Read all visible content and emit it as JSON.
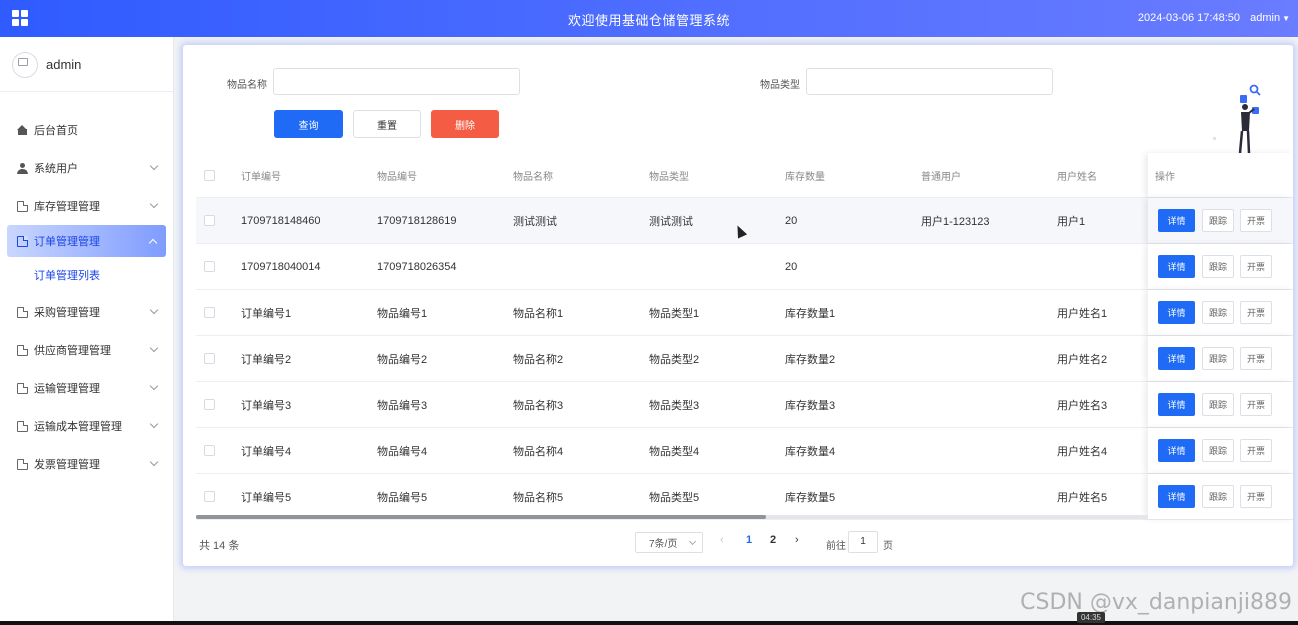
{
  "header": {
    "title": "欢迎使用基础仓储管理系统",
    "datetime": "2024-03-06 17:48:50",
    "user": "admin"
  },
  "sidebar": {
    "username": "admin",
    "items": [
      {
        "label": "后台首页",
        "icon": "home-icon"
      },
      {
        "label": "系统用户",
        "icon": "user-icon"
      },
      {
        "label": "库存管理管理",
        "icon": "document-icon"
      },
      {
        "label": "订单管理管理",
        "icon": "document-icon",
        "active": true
      },
      {
        "label": "采购管理管理",
        "icon": "document-icon"
      },
      {
        "label": "供应商管理管理",
        "icon": "document-icon"
      },
      {
        "label": "运输管理管理",
        "icon": "document-icon"
      },
      {
        "label": "运输成本管理管理",
        "icon": "document-icon"
      },
      {
        "label": "发票管理管理",
        "icon": "document-icon"
      }
    ],
    "subitem": "订单管理列表"
  },
  "search": {
    "name_label": "物品名称",
    "type_label": "物品类型",
    "query_button": "查询",
    "reset_button": "重置",
    "delete_button": "删除"
  },
  "table": {
    "headers": [
      "订单编号",
      "物品编号",
      "物品名称",
      "物品类型",
      "库存数量",
      "普通用户",
      "用户姓名",
      "操作"
    ],
    "actions": [
      "详情",
      "跟踪",
      "开票"
    ],
    "rows": [
      [
        "1709718148460",
        "1709718128619",
        "测试测试",
        "测试测试",
        "20",
        "用户1-123123",
        "用户1"
      ],
      [
        "1709718040014",
        "1709718026354",
        "",
        "",
        "20",
        "",
        ""
      ],
      [
        "订单编号1",
        "物品编号1",
        "物品名称1",
        "物品类型1",
        "库存数量1",
        "",
        "用户姓名1"
      ],
      [
        "订单编号2",
        "物品编号2",
        "物品名称2",
        "物品类型2",
        "库存数量2",
        "",
        "用户姓名2"
      ],
      [
        "订单编号3",
        "物品编号3",
        "物品名称3",
        "物品类型3",
        "库存数量3",
        "",
        "用户姓名3"
      ],
      [
        "订单编号4",
        "物品编号4",
        "物品名称4",
        "物品类型4",
        "库存数量4",
        "",
        "用户姓名4"
      ],
      [
        "订单编号5",
        "物品编号5",
        "物品名称5",
        "物品类型5",
        "库存数量5",
        "",
        "用户姓名5"
      ]
    ]
  },
  "pagination": {
    "total": "共 14 条",
    "page_size": "7条/页",
    "pages": [
      "1",
      "2"
    ],
    "current_page": "1",
    "goto_prefix": "前往",
    "goto_value": "1",
    "goto_suffix": "页"
  },
  "watermark": "CSDN @vx_danpianji889",
  "video_time": "04:35",
  "colors": {
    "header_start": "#2f5bff",
    "header_end": "#6a7cff",
    "primary": "#1f6bf5",
    "danger": "#f45c43"
  }
}
